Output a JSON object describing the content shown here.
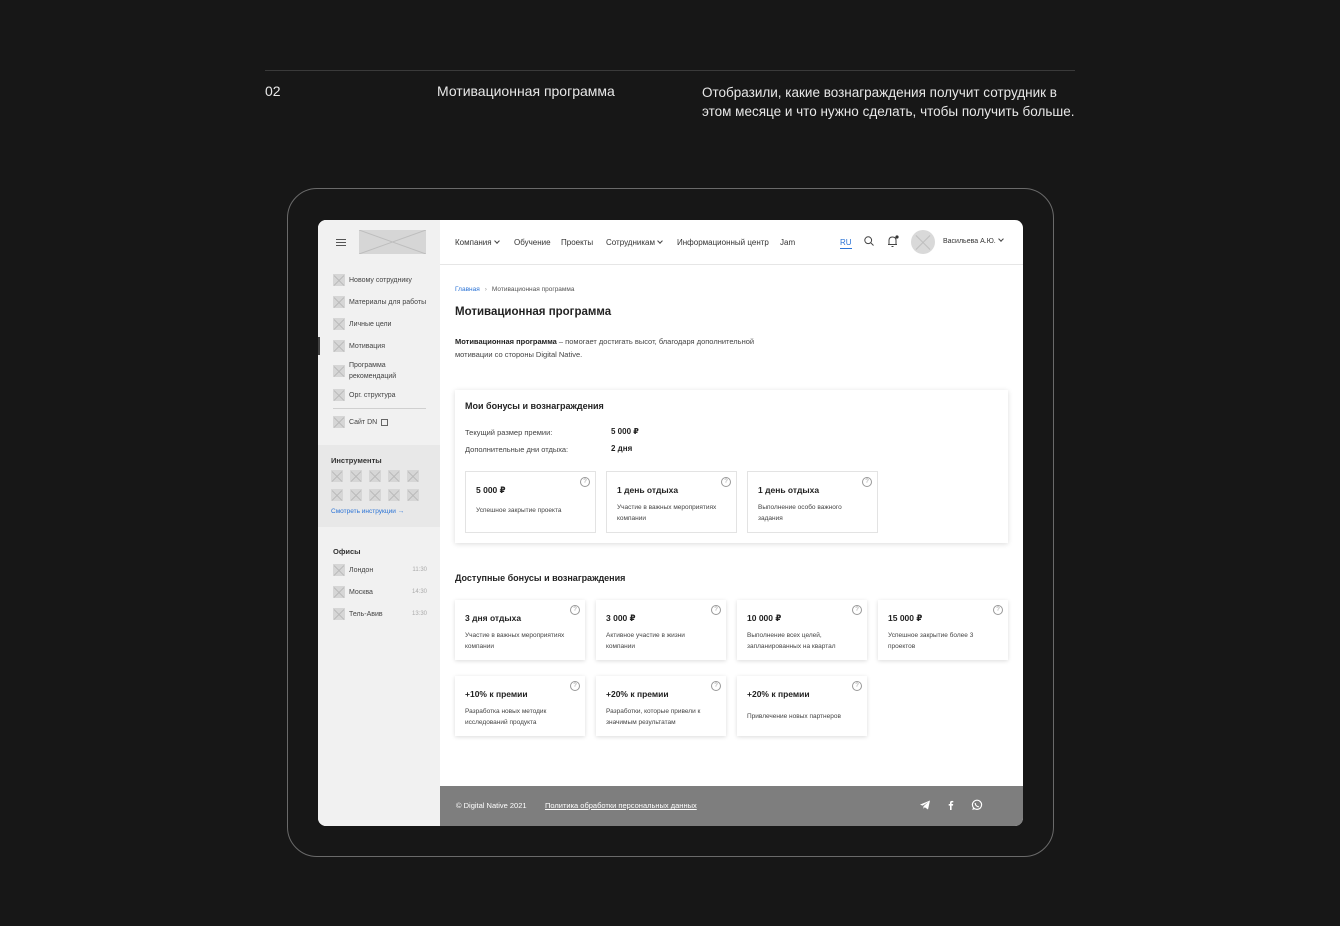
{
  "header": {
    "number": "02",
    "title": "Мотивационная программа",
    "description": "Отобразили, какие вознаграждения получит сотрудник в этом месяце и что нужно сделать, чтобы получить больше."
  },
  "sidebar": {
    "items": [
      {
        "label": "Новому сотруднику"
      },
      {
        "label": "Материалы для работы"
      },
      {
        "label": "Личные цели"
      },
      {
        "label": "Мотивация"
      },
      {
        "label": "Программа рекомендаций"
      },
      {
        "label": "Орг. структура"
      },
      {
        "label": "Сайт DN"
      }
    ],
    "tools_title": "Инструменты",
    "tools_link": "Смотреть инструкции →",
    "offices_title": "Офисы",
    "offices": [
      {
        "city": "Лондон",
        "time": "11:30"
      },
      {
        "city": "Москва",
        "time": "14:30"
      },
      {
        "city": "Тель-Авив",
        "time": "13:30"
      }
    ]
  },
  "nav": {
    "items": [
      "Компания",
      "Обучение",
      "Проекты",
      "Сотрудникам",
      "Информационный центр",
      "Jam"
    ],
    "lang": "RU",
    "user": "Васильева А.Ю."
  },
  "breadcrumb": {
    "home": "Главная",
    "current": "Мотивационная программа"
  },
  "page": {
    "title": "Мотивационная программа",
    "intro_bold": "Мотивационная программа",
    "intro_rest": " – помогает достигать высот, благодаря дополнительной мотивации со стороны Digital Native."
  },
  "my_bonuses": {
    "title": "Мои бонусы и вознаграждения",
    "bonus_label": "Текущий размер премии:",
    "bonus_value": "5 000 ₽",
    "days_label": "Дополнительные дни отдыха:",
    "days_value": "2 дня",
    "cards": [
      {
        "title": "5 000 ₽",
        "desc": "Успешное закрытие проекта"
      },
      {
        "title": "1 день отдыха",
        "desc": "Участие в важных мероприятиях компании"
      },
      {
        "title": "1 день отдыха",
        "desc": "Выполнение особо важного задания"
      }
    ]
  },
  "available": {
    "title": "Доступные бонусы и вознаграждения",
    "cards": [
      {
        "title": "3 дня отдыха",
        "desc": "Участие в важных мероприятиях компании"
      },
      {
        "title": "3 000 ₽",
        "desc": "Активное участие в жизни компании"
      },
      {
        "title": "10 000 ₽",
        "desc": "Выполнение всех целей, запланированных на квартал"
      },
      {
        "title": "15 000 ₽",
        "desc": "Успешное закрытие более 3 проектов"
      },
      {
        "title": "+10% к премии",
        "desc": "Разработка новых методик исследований продукта"
      },
      {
        "title": "+20% к премии",
        "desc": "Разработки, которые привели к значимым результатам"
      },
      {
        "title": "+20% к премии",
        "desc": "Привлечение новых партнеров"
      }
    ]
  },
  "footer": {
    "copyright": "© Digital Native 2021",
    "policy": "Политика обработки персональных данных"
  },
  "icons": {
    "help": "?"
  }
}
